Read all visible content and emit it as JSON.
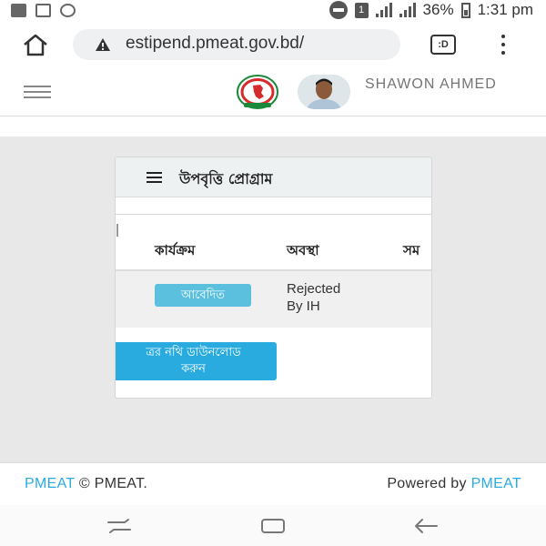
{
  "browser": {
    "url": "estipend.pmeat.gov.bd/",
    "tabs_label": ":D"
  },
  "status_bar": {
    "sim_label": "1",
    "battery": "36%",
    "time": "1:31 pm"
  },
  "header": {
    "user_name": "SHAWON AHMED"
  },
  "card": {
    "title": "উপবৃত্তি প্রোগ্রাম",
    "table": {
      "columns": [
        "কার্যক্রম",
        "অবস্থা",
        "সম"
      ],
      "rows": [
        {
          "action_label": "আবেদিত",
          "status": "Rejected\nBy IH"
        }
      ]
    },
    "download_button": {
      "line1": "ত্রর নথি ডাউনলোড",
      "line2": "করুন"
    }
  },
  "footer": {
    "left_link": "PMEAT",
    "left_text": "© PMEAT.",
    "right_prefix": "Powered by",
    "right_link": "PMEAT"
  },
  "colors": {
    "accent": "#29abe0",
    "badge": "#5bc0de",
    "page_bg": "#e8e8e8"
  }
}
